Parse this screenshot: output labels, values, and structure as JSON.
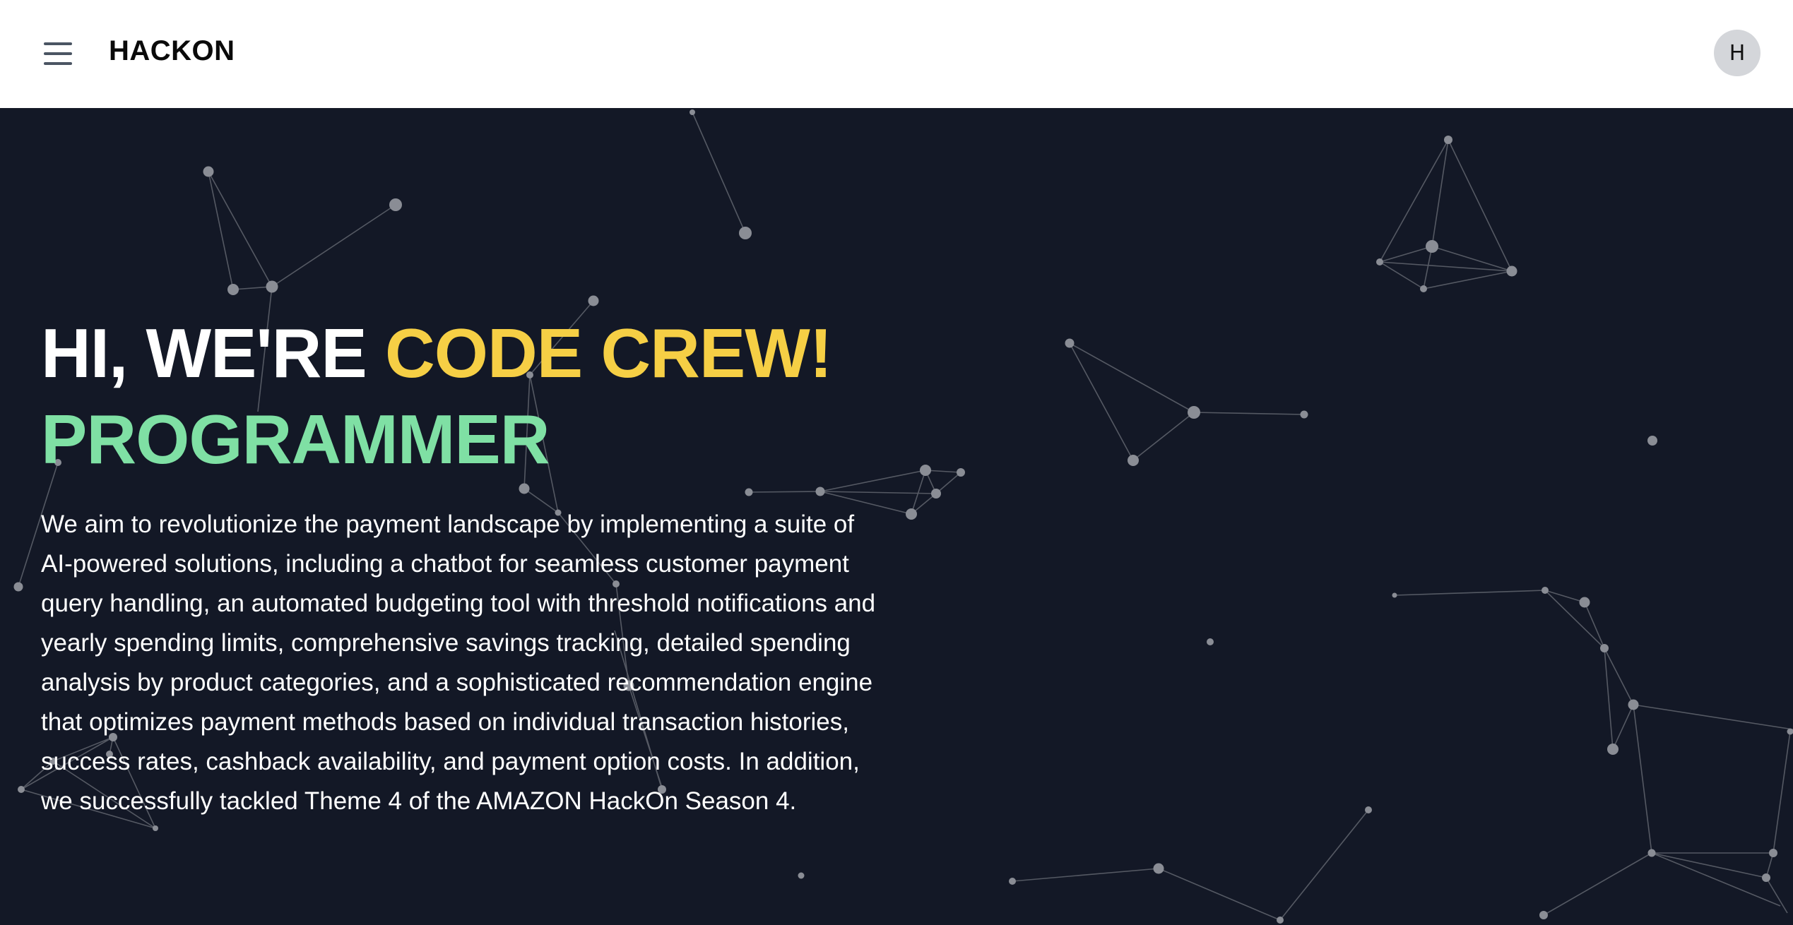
{
  "header": {
    "brand": "HACKON",
    "avatar_initial": "H"
  },
  "hero": {
    "greeting": "HI, WE'RE",
    "team_name": "CODE CREW!",
    "role": "PROGRAMMER",
    "description": "We aim to revolutionize the payment landscape by implementing a suite of AI-powered solutions, including a chatbot for seamless customer payment query handling, an automated budgeting tool with threshold notifications and yearly spending limits, comprehensive savings tracking, detailed spending analysis by product categories, and a sophisticated recommendation engine that optimizes payment methods based on individual transaction histories, success rates, cashback availability, and payment option costs. In addition, we successfully tackled Theme 4 of the AMAZON HackOn Season 4."
  },
  "colors": {
    "background": "#131826",
    "header_bg": "#ffffff",
    "accent_yellow": "#f6cf45",
    "accent_green": "#7fe0a4",
    "node": "#8a8d95"
  },
  "icons": {
    "menu": "hamburger-menu-icon"
  }
}
